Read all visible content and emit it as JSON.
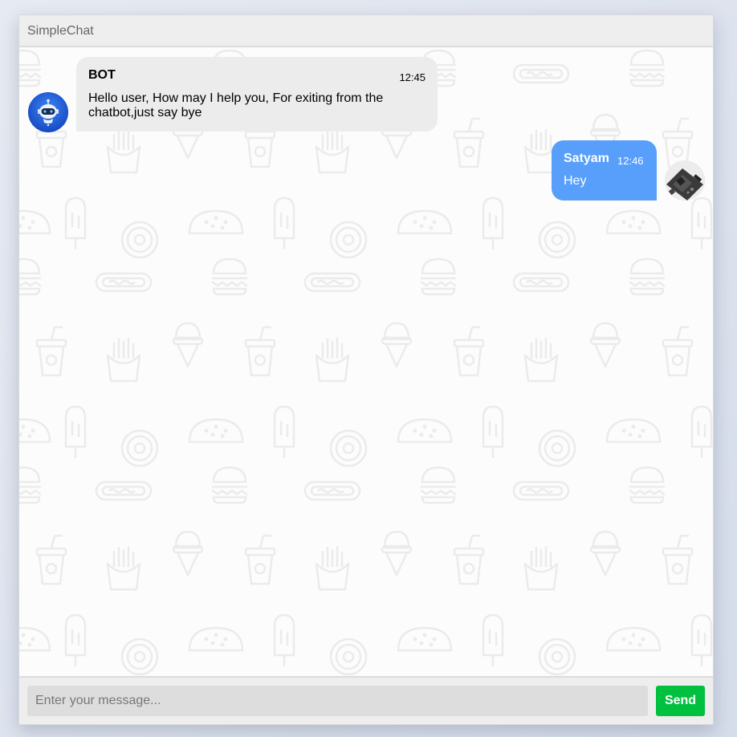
{
  "app": {
    "title": "SimpleChat"
  },
  "messages": [
    {
      "sender": "BOT",
      "time": "12:45",
      "text": "Hello user, How may I help you, For exiting from the chatbot,just say bye",
      "side": "left",
      "avatar_icon": "robot-icon"
    },
    {
      "sender": "Satyam",
      "time": "12:46",
      "text": "Hey",
      "side": "right",
      "avatar_icon": "user-photo-icon"
    }
  ],
  "composer": {
    "placeholder": "Enter your message...",
    "value": "",
    "send_label": "Send"
  },
  "colors": {
    "header_bg": "#eeeeee",
    "bot_bubble": "#ececec",
    "user_bubble": "#579ffb",
    "send_button": "#00c13f",
    "doodle_stroke": "#ececec"
  },
  "background_pattern_icons": [
    "burger-icon",
    "hotdog-icon",
    "soda-cup-icon",
    "ice-cream-icon",
    "fries-icon",
    "taco-icon",
    "donut-icon",
    "popsicle-icon"
  ]
}
